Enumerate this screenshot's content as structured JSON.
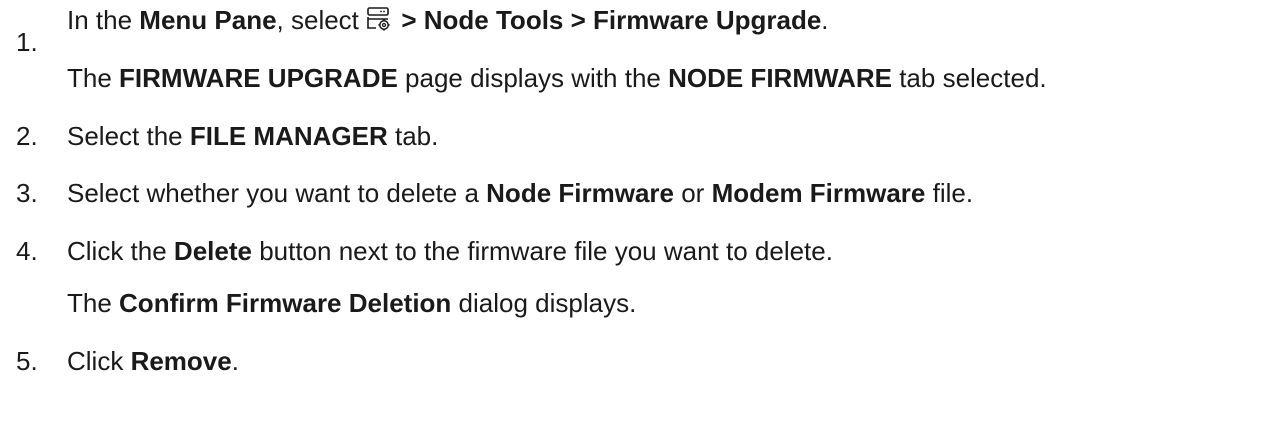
{
  "steps": [
    {
      "number": "1.",
      "parts": {
        "t1": "In the ",
        "b1": "Menu Pane",
        "t2": ", select ",
        "b2": " > Node Tools > Firmware Upgrade",
        "t3": "."
      },
      "icon": "server-settings-icon",
      "result": {
        "t1": "The ",
        "b1": "FIRMWARE UPGRADE",
        "t2": " page displays with the ",
        "b2": "NODE FIRMWARE",
        "t3": " tab selected."
      }
    },
    {
      "number": "2.",
      "parts": {
        "t1": "Select the ",
        "b1": "FILE MANAGER",
        "t2": " tab."
      }
    },
    {
      "number": "3.",
      "parts": {
        "t1": "Select whether you want to delete a ",
        "b1": "Node Firmware",
        "t2": " or ",
        "b2": "Modem Firmware",
        "t3": " file."
      }
    },
    {
      "number": "4.",
      "parts": {
        "t1": "Click the ",
        "b1": "Delete",
        "t2": " button next to the firmware file you want to delete."
      },
      "result": {
        "t1": "The ",
        "b1": "Confirm Firmware Deletion",
        "t2": " dialog displays."
      }
    },
    {
      "number": "5.",
      "parts": {
        "t1": "Click ",
        "b1": "Remove",
        "t2": "."
      }
    }
  ]
}
